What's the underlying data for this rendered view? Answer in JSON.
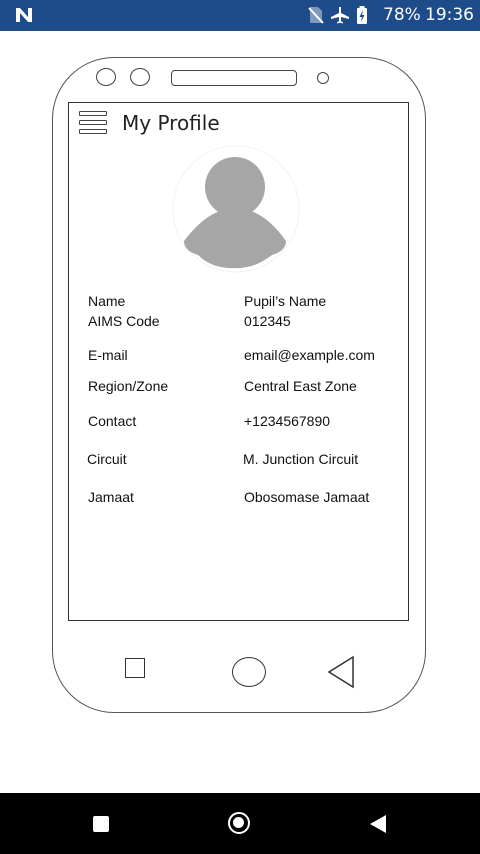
{
  "status_bar": {
    "battery": "78%",
    "time": "19:36",
    "icons": [
      "n-logo-icon",
      "no-sim-icon",
      "airplane-mode-icon",
      "battery-icon"
    ]
  },
  "header": {
    "title": "My Profile",
    "menu_icon": "hamburger-menu-icon"
  },
  "profile": {
    "avatar_icon": "user-avatar-icon",
    "fields": [
      {
        "label": "Name",
        "value": "Pupil’s Name"
      },
      {
        "label": "AIMS Code",
        "value": "012345"
      },
      {
        "label": "E-mail",
        "value": "email@example.com"
      },
      {
        "label": "Region/Zone",
        "value": "Central East Zone"
      },
      {
        "label": "Contact",
        "value": "+1234567890"
      },
      {
        "label": "Circuit",
        "value": "M. Junction Circuit"
      },
      {
        "label": "Jamaat",
        "value": "Obosomase Jamaat"
      }
    ]
  },
  "colors": {
    "status_bar": "#1e4c8a",
    "avatar": "#a6a6a6",
    "nav_bar": "#000000"
  }
}
